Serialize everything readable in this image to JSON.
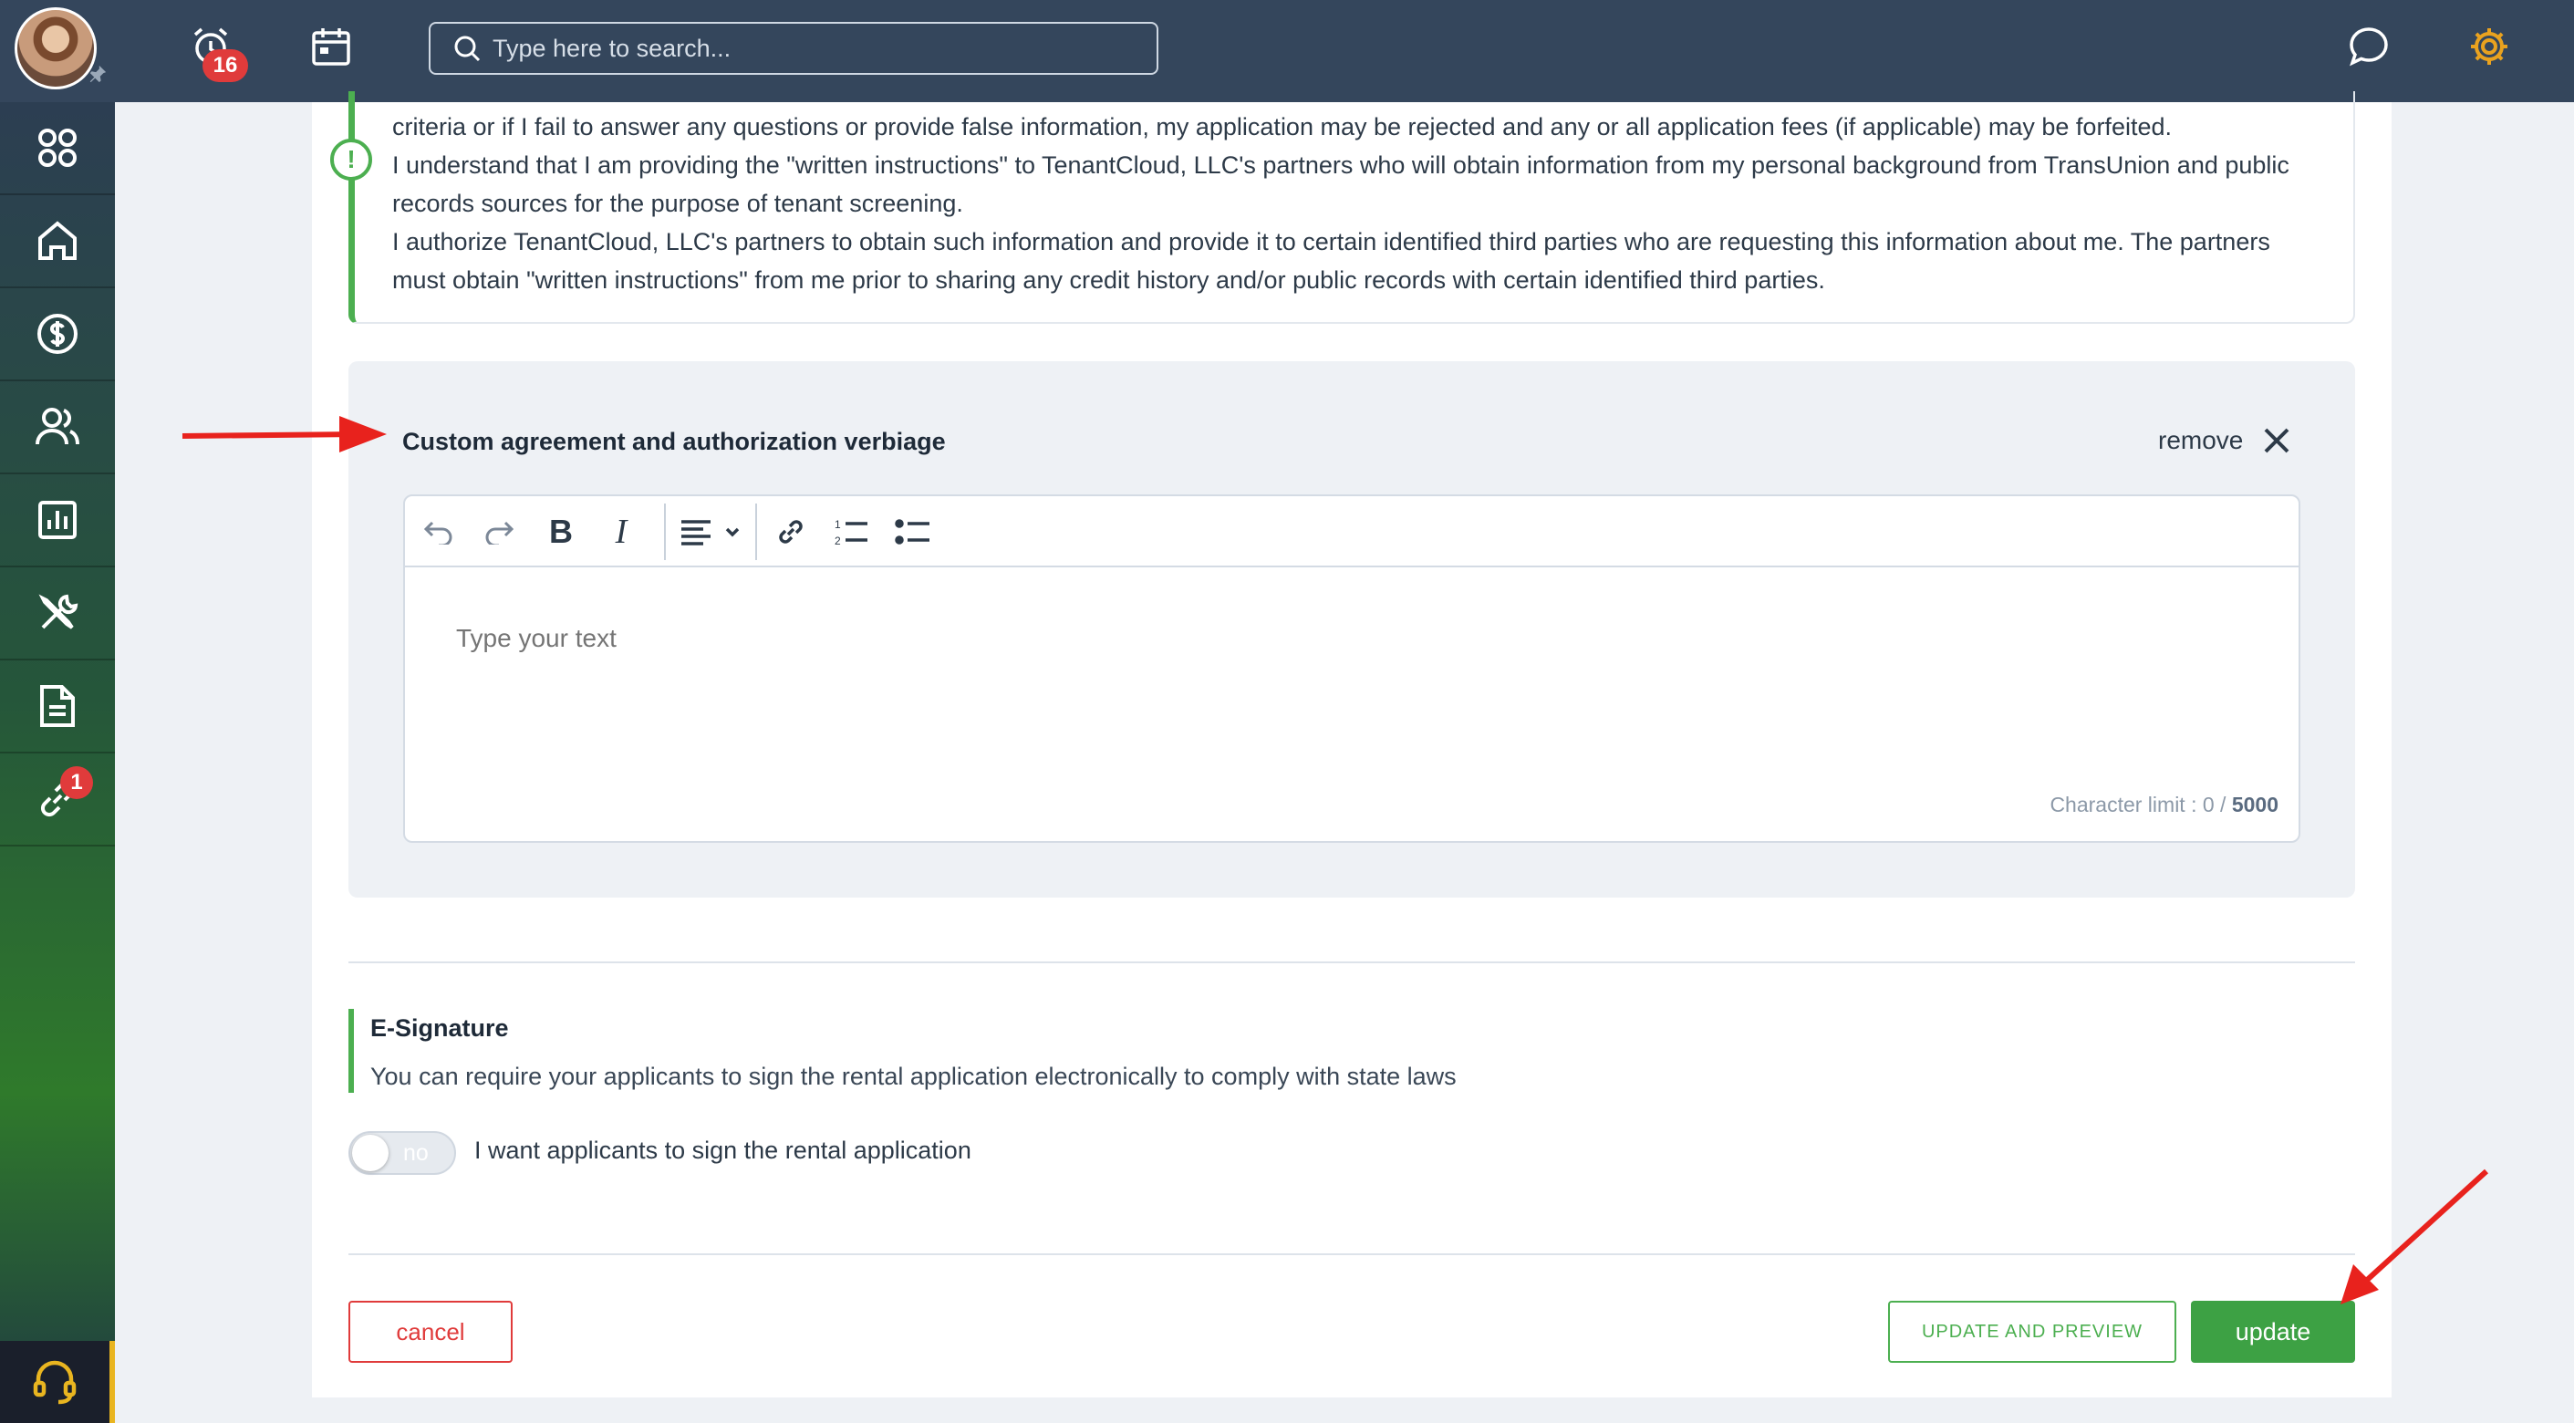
{
  "topbar": {
    "alerts_badge": "16",
    "search_placeholder": "Type here to search...",
    "accent_color": "#e9a21f"
  },
  "sidebar": {
    "items": [
      {
        "icon": "grid-icon"
      },
      {
        "icon": "home-icon"
      },
      {
        "icon": "dollar-icon"
      },
      {
        "icon": "users-icon"
      },
      {
        "icon": "chart-icon"
      },
      {
        "icon": "tools-icon"
      },
      {
        "icon": "document-icon"
      },
      {
        "icon": "link-icon",
        "badge": "1"
      }
    ],
    "support_icon": "headset-icon"
  },
  "agreement": {
    "lines": [
      "criteria or if I fail to answer any questions or provide false information, my application may be rejected and any or all application fees (if applicable) may be forfeited.",
      "I understand that I am providing the \"written instructions\" to TenantCloud, LLC's partners who will obtain information from my personal background from TransUnion and public records sources for the purpose of tenant screening.",
      "I authorize TenantCloud, LLC's partners to obtain such information and provide it to certain identified third parties who are requesting this information about me. The partners must obtain \"written instructions\" from me prior to sharing any credit history and/or public records with certain identified third parties."
    ]
  },
  "custom": {
    "title": "Custom agreement and authorization verbiage",
    "remove_label": "remove",
    "editor_placeholder": "Type your text",
    "char_limit_label": "Character limit : 0 / ",
    "char_limit_max": "5000"
  },
  "esignature": {
    "title": "E-Signature",
    "description": "You can require your applicants to sign the rental application electronically to comply with state laws",
    "toggle_state": "no",
    "toggle_label": "I want applicants to sign the rental application"
  },
  "actions": {
    "cancel_label": "cancel",
    "preview_label": "UPDATE AND PREVIEW",
    "update_label": "update"
  },
  "colors": {
    "primary_green": "#4caf50",
    "danger_red": "#e03b3b",
    "topbar": "#34465c"
  }
}
